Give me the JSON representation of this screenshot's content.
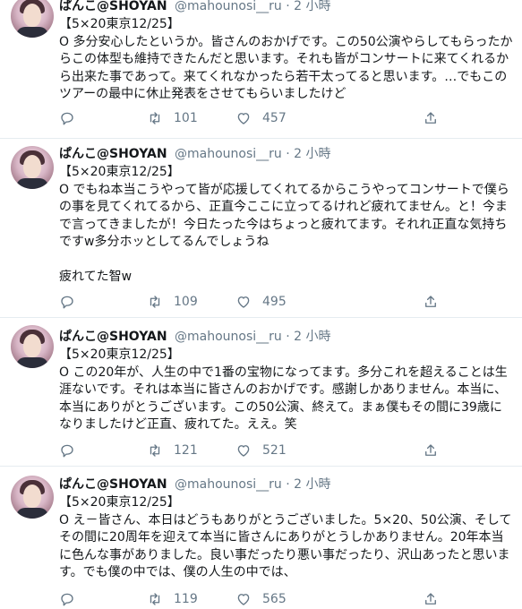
{
  "feed": {
    "tweets": [
      {
        "user": {
          "display_name": "ぱんこ@SHOYAN",
          "handle": "@mahounosi__ru",
          "separator": "·",
          "time": "2 小時"
        },
        "text": "【5×20東京12/25】\nO 多分安心したというか。皆さんのおかげです。この50公演やらしてもらったからこの体型も維持できたんだと思います。それも皆がコンサートに来てくれるから出来た事であって。来てくれなかったら若干太ってると思います。…でもこのツアーの最中に休止発表をさせてもらいましたけど",
        "retweets": "101",
        "likes": "457"
      },
      {
        "user": {
          "display_name": "ぱんこ@SHOYAN",
          "handle": "@mahounosi__ru",
          "separator": "·",
          "time": "2 小時"
        },
        "text": "【5×20東京12/25】\nO でもね本当こうやって皆が応援してくれてるからこうやってコンサートで僕らの事を見てくれてるから、正直今ここに立ってるけれど疲れてません。と！今まで言ってきましたが！今日たった今はちょっと疲れてます。それれ正直な気持ちですw多分ホッとしてるんでしょうね\n\n疲れてた智w",
        "retweets": "109",
        "likes": "495"
      },
      {
        "user": {
          "display_name": "ぱんこ@SHOYAN",
          "handle": "@mahounosi__ru",
          "separator": "·",
          "time": "2 小時"
        },
        "text": "【5×20東京12/25】\nO この20年が、人生の中で1番の宝物になってます。多分これを超えることは生涯ないです。それは本当に皆さんのおかげです。感謝しかありません。本当に、本当にありがとうございます。この50公演、終えて。まぁ僕もその間に39歳になりましたけど正直、疲れてた。ええ。笑",
        "retweets": "121",
        "likes": "521"
      },
      {
        "user": {
          "display_name": "ぱんこ@SHOYAN",
          "handle": "@mahounosi__ru",
          "separator": "·",
          "time": "2 小時"
        },
        "text": "【5×20東京12/25】\nO え－皆さん、本日はどうもありがとうございました。5×20、50公演、そしてその間に20周年を迎えて本当に皆さんにありがとうしかありません。20年本当に色んな事がありました。良い事だったり悪い事だったり、沢山あったと思います。でも僕の中では、僕の人生の中では、",
        "retweets": "119",
        "likes": "565"
      }
    ]
  },
  "icons": {
    "reply": "reply-icon",
    "retweet": "retweet-icon",
    "like": "heart-icon",
    "share": "share-icon"
  },
  "colors": {
    "text": "#14171a",
    "secondary": "#657786",
    "divider": "#e6ecf0"
  }
}
